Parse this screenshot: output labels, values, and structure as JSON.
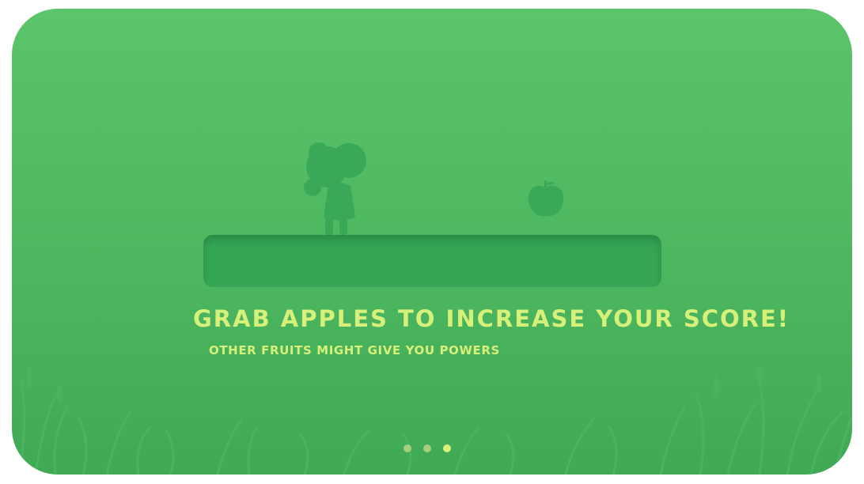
{
  "slide": {
    "title": "Grab apples to increase your score!",
    "subtitle": "Other fruits might give you powers"
  },
  "pager": {
    "count": 3,
    "active_index": 2
  },
  "colors": {
    "background_top": "#5cc46a",
    "background_bottom": "#3fa956",
    "platform": "#33a553",
    "silhouette": "#3aa957",
    "text_accent": "#d6f07a"
  },
  "icons": {
    "character": "girl-silhouette-icon",
    "apple": "apple-icon"
  }
}
